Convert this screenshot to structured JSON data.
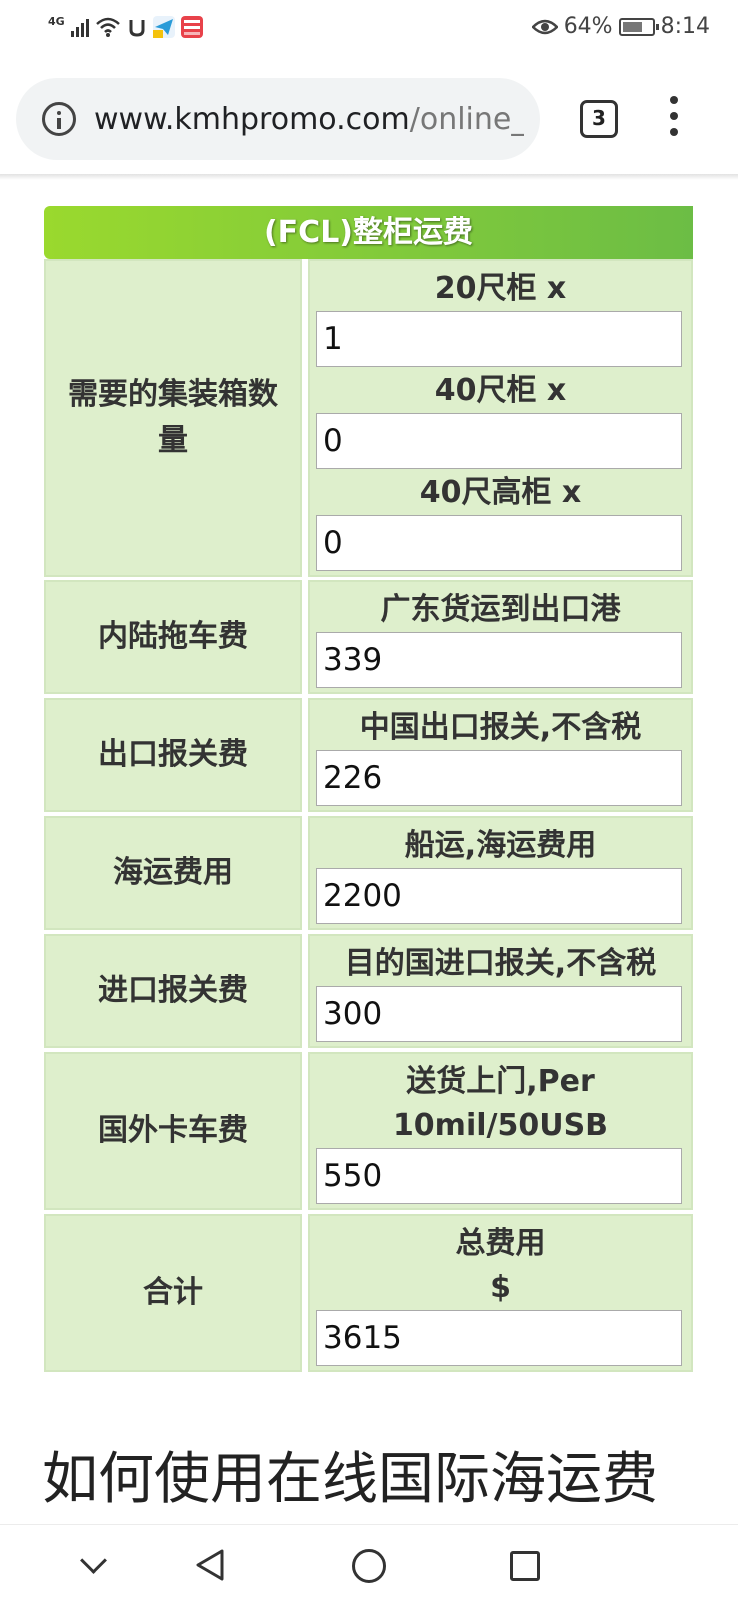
{
  "status_bar": {
    "network": "4G",
    "battery": "64%",
    "time": "8:14"
  },
  "browser": {
    "url_host": "www.kmhpromo.com",
    "url_path": "/online_",
    "tab_count": "3"
  },
  "table": {
    "header": "(FCL)整柜运费",
    "rows": [
      {
        "label": "需要的集装箱数量",
        "fields": [
          {
            "label": "20尺柜 x",
            "value": "1"
          },
          {
            "label": "40尺柜 x",
            "value": "0"
          },
          {
            "label": "40尺高柜 x",
            "value": "0"
          }
        ]
      },
      {
        "label": "内陆拖车费",
        "sub_label": "广东货运到出口港",
        "value": "339"
      },
      {
        "label": "出口报关费",
        "sub_label": "中国出口报关,不含税",
        "value": "226"
      },
      {
        "label": "海运费用",
        "sub_label": "船运,海运费用",
        "value": "2200"
      },
      {
        "label": "进口报关费",
        "sub_label": "目的国进口报关,不含税",
        "value": "300"
      },
      {
        "label": "国外卡车费",
        "sub_label_line1": "送货上门,Per",
        "sub_label_line2": "10mil/50USB",
        "value": "550"
      },
      {
        "label": "合计",
        "sub_label_line1": "总费用",
        "sub_label_line2": "$",
        "value": "3615"
      }
    ]
  },
  "how_to_title": "如何使用在线国际海运费"
}
